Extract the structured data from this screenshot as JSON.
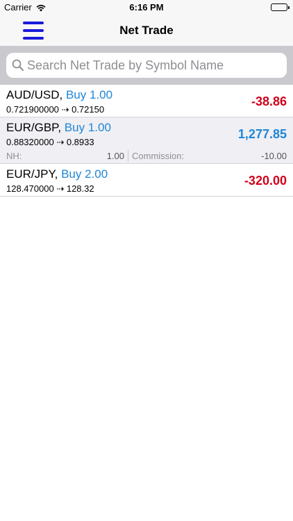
{
  "status_bar": {
    "carrier": "Carrier",
    "time": "6:16 PM",
    "wifi_icon": "wifi-icon",
    "battery_icon": "battery-icon"
  },
  "nav": {
    "title": "Net Trade",
    "menu_icon": "hamburger-menu-icon",
    "accent_color": "#1a1adb"
  },
  "search": {
    "placeholder": "Search Net Trade by Symbol Name",
    "value": "",
    "icon": "search-icon"
  },
  "colors": {
    "buy": "#1f86d6",
    "profit": "#1f86d6",
    "loss": "#d0021b"
  },
  "trades": [
    {
      "symbol": "AUD/USD,",
      "action": "Buy 1.00",
      "open_price": "0.721900000",
      "current_price": "0.72150",
      "pnl": "-38.86"
    },
    {
      "symbol": "EUR/GBP,",
      "action": "Buy 1.00",
      "open_price": "0.88320000",
      "current_price": "0.8933",
      "pnl": "1,277.85",
      "nh_label": "NH:",
      "nh_value": "1.00",
      "commission_label": "Commission:",
      "commission_value": "-10.00"
    },
    {
      "symbol": "EUR/JPY,",
      "action": "Buy 2.00",
      "open_price": "128.470000",
      "current_price": "128.32",
      "pnl": "-320.00"
    }
  ],
  "price_arrow": "⇢"
}
